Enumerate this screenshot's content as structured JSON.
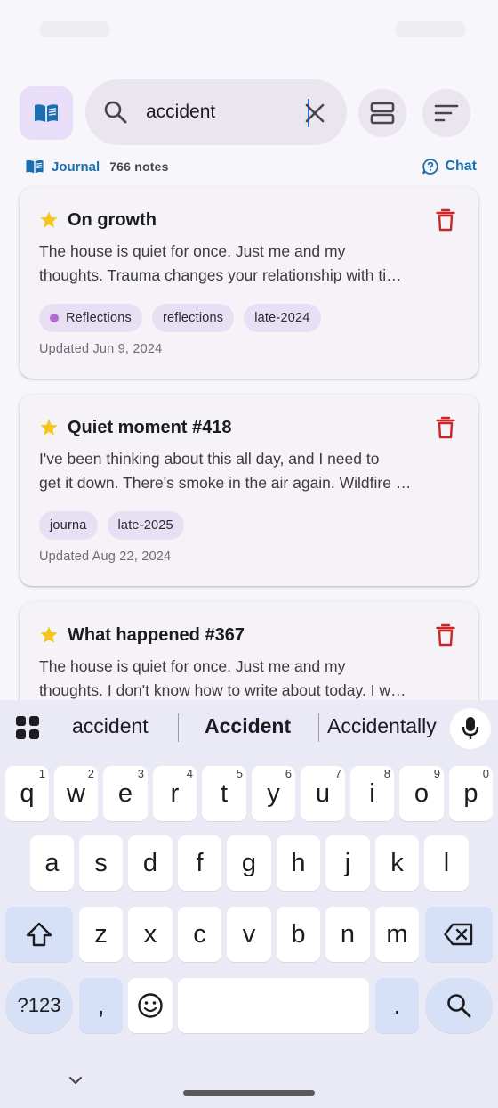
{
  "search": {
    "value": "accident"
  },
  "subheader": {
    "journal_label": "Journal",
    "count": "766 notes",
    "chat_label": "Chat"
  },
  "colors": {
    "accent": "#1a6fb0",
    "star": "#f6c51b",
    "trash": "#c62828",
    "tag_bg": "#e8dff5",
    "tag_dot": "#b06ad6"
  },
  "notes": [
    {
      "title": "On growth",
      "starred": true,
      "body_lines": [
        "The house is quiet for once. Just me and my",
        "thoughts. Trauma changes your relationship with ti…"
      ],
      "tags": [
        "Reflections",
        "reflections",
        "late-2024"
      ],
      "updated": "Updated Jun 9, 2024"
    },
    {
      "title": "Quiet moment #418",
      "starred": true,
      "body_lines": [
        "I've been thinking about this all day, and I need to",
        "get it down. There's smoke in the air again. Wildfire …"
      ],
      "tags": [
        "journa",
        "late-2025"
      ],
      "updated": "Updated Aug 22, 2024"
    },
    {
      "title": "What happened #367",
      "starred": true,
      "body_lines": [
        "The house is quiet for once. Just me and my",
        "thoughts. I don't know how to write about today. I w…"
      ]
    }
  ],
  "keyboard": {
    "suggestions": [
      "accident",
      "Accident",
      "Accidentally"
    ],
    "row1": [
      "q",
      "w",
      "e",
      "r",
      "t",
      "y",
      "u",
      "i",
      "o",
      "p"
    ],
    "row1_hints": [
      "1",
      "2",
      "3",
      "4",
      "5",
      "6",
      "7",
      "8",
      "9",
      "0"
    ],
    "row2": [
      "a",
      "s",
      "d",
      "f",
      "g",
      "h",
      "j",
      "k",
      "l"
    ],
    "row3": [
      "z",
      "x",
      "c",
      "v",
      "b",
      "n",
      "m"
    ],
    "symbols_label": "?123",
    "comma": ",",
    "period": "."
  }
}
